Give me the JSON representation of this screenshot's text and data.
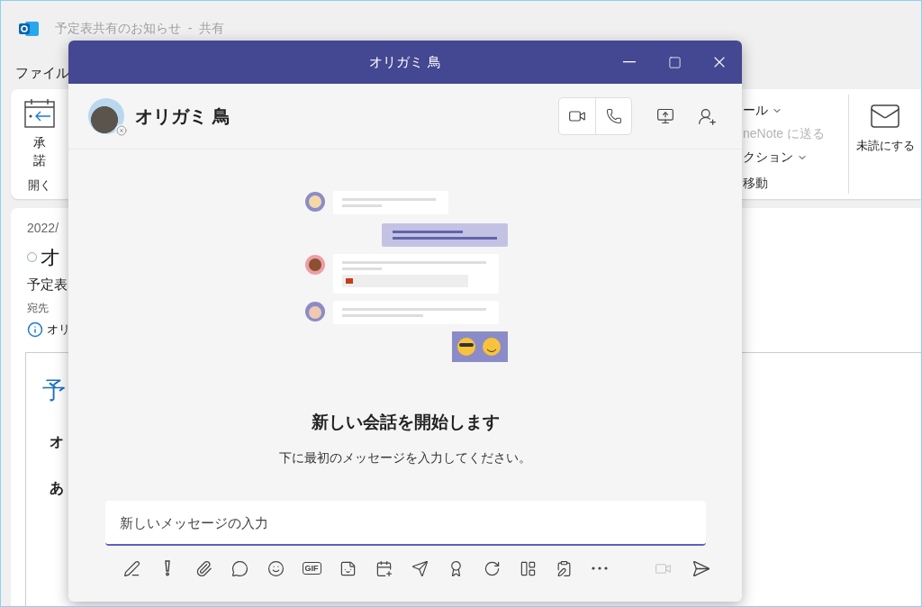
{
  "outlook": {
    "title": "予定表共有のお知らせ  -  共有",
    "menu": [
      {
        "label": "ファイル"
      }
    ],
    "accept_button": {
      "label": "承諾"
    },
    "open_group_label": "開く",
    "actions": [
      {
        "label": "ール",
        "dropdown": true,
        "disabled": false
      },
      {
        "label": "neNote に送る",
        "dropdown": false,
        "disabled": true
      },
      {
        "label": "クション",
        "dropdown": true,
        "disabled": false
      }
    ],
    "move_group_label": "移動",
    "unread_button": {
      "label": "未読にする"
    }
  },
  "message": {
    "date": "2022/",
    "subject": "オ",
    "subject_line": "予定表",
    "to_label": "宛先",
    "recipient": "オリ",
    "body_heading": "予",
    "body_lines": [
      "オ",
      "あ"
    ]
  },
  "chat": {
    "title": "オリガミ 鳥",
    "contact": {
      "name": "オリガミ 鳥",
      "offline": true
    },
    "empty_state": {
      "heading": "新しい会話を開始します",
      "text": "下に最初のメッセージを入力してください。"
    },
    "composer": {
      "placeholder": "新しいメッセージの入力"
    },
    "toolbar": [
      {
        "kind": "format",
        "disabled": false
      },
      {
        "kind": "important",
        "disabled": false
      },
      {
        "kind": "attach",
        "disabled": false
      },
      {
        "kind": "loop",
        "disabled": false
      },
      {
        "kind": "emoji",
        "disabled": false
      },
      {
        "kind": "gif",
        "label": "GIF",
        "disabled": false
      },
      {
        "kind": "sticker",
        "disabled": false
      },
      {
        "kind": "schedule",
        "disabled": false
      },
      {
        "kind": "send-later",
        "disabled": false
      },
      {
        "kind": "praise",
        "disabled": false
      },
      {
        "kind": "update",
        "disabled": false
      },
      {
        "kind": "planner",
        "disabled": false
      },
      {
        "kind": "approvals",
        "disabled": false
      },
      {
        "kind": "more",
        "disabled": false
      }
    ],
    "actions": [
      {
        "kind": "meet-now",
        "disabled": true
      },
      {
        "kind": "send",
        "disabled": false
      }
    ]
  }
}
